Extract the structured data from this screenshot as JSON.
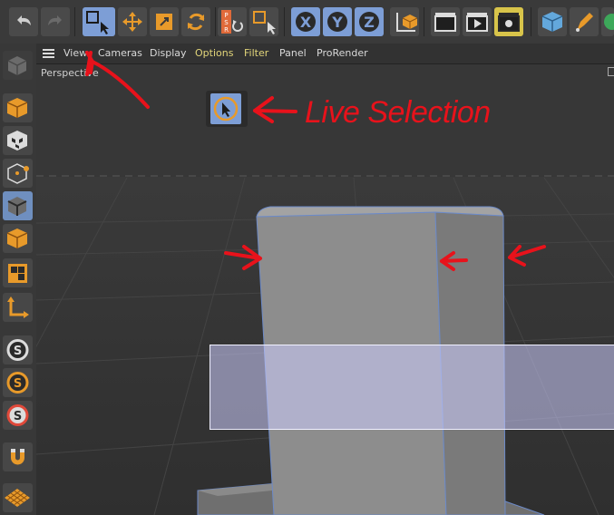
{
  "menubar": {
    "items": [
      "View",
      "Cameras",
      "Display",
      "Options",
      "Filter",
      "Panel",
      "ProRender"
    ]
  },
  "viewport": {
    "label": "Perspective"
  },
  "annotation": {
    "text": "Live Selection",
    "color": "#e8121b"
  },
  "toolbar": {
    "xyz": [
      "X",
      "Y",
      "Z"
    ],
    "psr": [
      "P",
      "S",
      "R"
    ]
  },
  "colors": {
    "active_blue": "#7d9ed6",
    "background": "#373737",
    "object": "#8d8d8d"
  }
}
